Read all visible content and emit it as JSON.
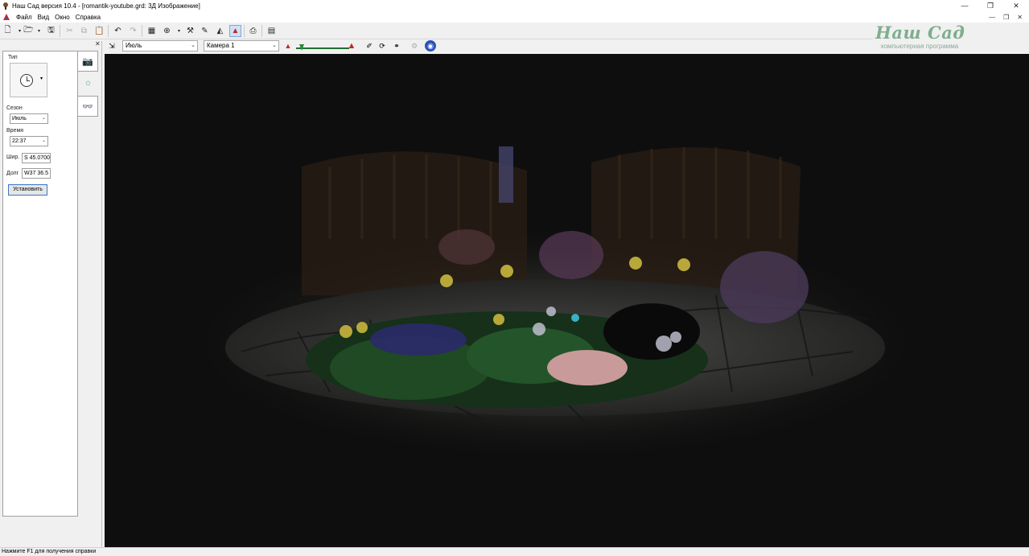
{
  "window": {
    "title": "Наш Сад версия 10.4 - [romantik-youtube.grd: 3Д Изображение]",
    "controls": {
      "minimize": "—",
      "restore": "❐",
      "close": "✕"
    }
  },
  "menu": {
    "items": [
      "Файл",
      "Вид",
      "Окно",
      "Справка"
    ],
    "mdi_controls": {
      "minimize": "—",
      "restore": "❐",
      "close": "✕"
    }
  },
  "logo": {
    "title": "Наш Сад",
    "subtitle": "компьютерная программа"
  },
  "view_toolbar": {
    "month": "Июль",
    "camera": "Камера 1"
  },
  "left_panel": {
    "type_label": "Тип",
    "season_label": "Сезон",
    "season_value": "Июль",
    "time_label": "Время",
    "time_value": "22:37",
    "lat_label": "Шир.",
    "lat_value": "S 45.0700",
    "lon_label": "Долг",
    "lon_value": "W37 36.5",
    "set_button": "Установить"
  },
  "status": {
    "text": "Нажмите F1 для получения справки"
  },
  "colors": {
    "accent": "#3a78c8",
    "logo": "#7fae8e",
    "viewport_bg": "#0e0e0e"
  }
}
